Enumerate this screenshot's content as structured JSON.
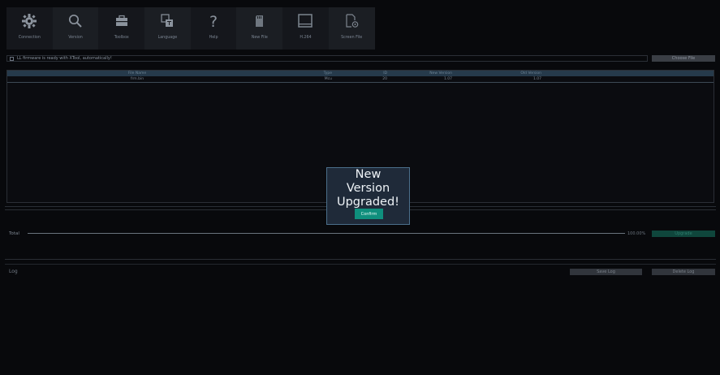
{
  "toolbar": {
    "items": [
      {
        "label": "Connection",
        "icon": "gear-icon"
      },
      {
        "label": "Version",
        "icon": "search-icon"
      },
      {
        "label": "Toolbox",
        "icon": "toolbox-icon"
      },
      {
        "label": "Language",
        "icon": "language-icon"
      },
      {
        "label": "Help",
        "icon": "help-icon"
      },
      {
        "label": "New File",
        "icon": "sd-card-icon"
      },
      {
        "label": "H.264",
        "icon": "monitor-icon"
      },
      {
        "label": "Screen File",
        "icon": "file-settings-icon"
      }
    ]
  },
  "status": {
    "text": "LL firmware is ready with XTool, automatically!",
    "choose_file": "Choose File"
  },
  "table": {
    "headers": [
      "File Name",
      "Type",
      "ID",
      "New Version",
      "Old Version"
    ],
    "rows": [
      [
        "frm.bin",
        "Mcu",
        "20",
        "1.07",
        "1.07"
      ]
    ]
  },
  "progress": {
    "label": "Total",
    "percent_text": "100.00%",
    "percent": 100,
    "upgrade_label": "Upgrade"
  },
  "log": {
    "label": "Log",
    "save_label": "Save Log",
    "delete_label": "Delete Log"
  },
  "dialog": {
    "message": "New\nVersion\nUpgraded!",
    "confirm_label": "Confirm"
  },
  "colors": {
    "accent": "#0f8f7d",
    "background": "#08090c",
    "dialog_bg": "#1f2a39"
  }
}
